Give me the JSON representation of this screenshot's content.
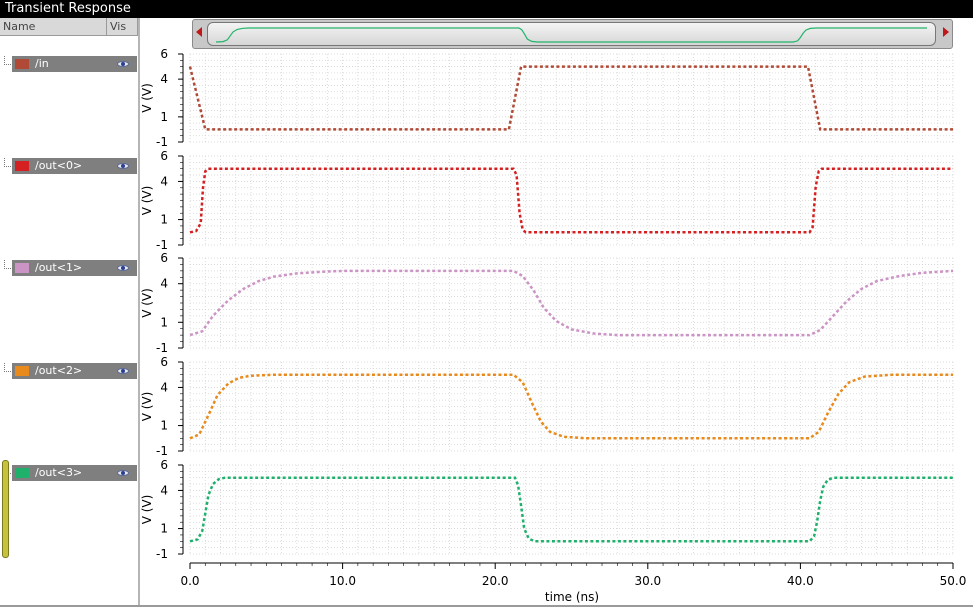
{
  "window": {
    "title": "Transient Response"
  },
  "legend_panel": {
    "col_name": "Name",
    "col_vis": "Vis",
    "signals": [
      {
        "label": "/in",
        "color": "#b04a36"
      },
      {
        "label": "/out<0>",
        "color": "#d42020"
      },
      {
        "label": "/out<1>",
        "color": "#cc94c4"
      },
      {
        "label": "/out<2>",
        "color": "#e88a1c"
      },
      {
        "label": "/out<3>",
        "color": "#1fb06c"
      }
    ]
  },
  "chart_data": {
    "type": "line",
    "xlabel": "time (ns)",
    "xlim": [
      0,
      50
    ],
    "xticks": [
      "0.0",
      "10.0",
      "20.0",
      "30.0",
      "40.0",
      "50.0"
    ],
    "ylabel": "V (V)",
    "ylim": [
      -1,
      6
    ],
    "yticks": [
      "6",
      "4",
      "1",
      "-1"
    ],
    "grid": true,
    "series": [
      {
        "name": "/in",
        "color": "#b04a36",
        "x": [
          0,
          1.0,
          20.9,
          21.7,
          40.5,
          41.3,
          50
        ],
        "y": [
          5,
          0,
          0,
          5,
          5,
          0,
          0
        ]
      },
      {
        "name": "/out<0>",
        "color": "#d42020",
        "x": [
          0,
          0.4,
          0.7,
          0.85,
          1.0,
          1.2,
          21.2,
          21.4,
          21.6,
          21.8,
          22.0,
          40.6,
          40.8,
          41.0,
          41.2,
          41.4,
          50
        ],
        "y": [
          0,
          0.1,
          0.7,
          3.5,
          4.8,
          5,
          5,
          4.5,
          1.5,
          0.2,
          0,
          0,
          0.4,
          3.6,
          4.8,
          5,
          5
        ]
      },
      {
        "name": "/out<1>",
        "color": "#cc94c4",
        "x": [
          0,
          0.8,
          1.5,
          2.5,
          3.5,
          4.5,
          5.5,
          7,
          8.5,
          10,
          21.2,
          21.8,
          22.5,
          23.2,
          24,
          25,
          26.5,
          28,
          40.6,
          41.3,
          42,
          43,
          44,
          45,
          46.5,
          48,
          50
        ],
        "y": [
          0,
          0.3,
          1.5,
          2.7,
          3.6,
          4.2,
          4.55,
          4.8,
          4.92,
          5,
          5,
          4.6,
          3.5,
          2.1,
          1.1,
          0.45,
          0.12,
          0,
          0,
          0.4,
          1.3,
          2.6,
          3.6,
          4.2,
          4.6,
          4.85,
          5
        ]
      },
      {
        "name": "/out<2>",
        "color": "#e88a1c",
        "x": [
          0,
          0.6,
          1.2,
          1.8,
          2.5,
          3.2,
          4,
          5.5,
          21.2,
          21.8,
          22.4,
          23.0,
          23.6,
          24.5,
          26,
          40.6,
          41.2,
          41.8,
          42.5,
          43.2,
          44.2,
          46,
          50
        ],
        "y": [
          0,
          0.3,
          1.8,
          3.4,
          4.3,
          4.75,
          4.92,
          5,
          5,
          4.4,
          2.8,
          1.3,
          0.5,
          0.12,
          0,
          0,
          0.5,
          2.0,
          3.5,
          4.4,
          4.85,
          5,
          5
        ]
      },
      {
        "name": "/out<3>",
        "color": "#1fb06c",
        "x": [
          0,
          0.5,
          0.8,
          1.0,
          1.2,
          1.5,
          1.9,
          2.3,
          21.3,
          21.5,
          21.7,
          21.9,
          22.2,
          22.6,
          40.6,
          40.9,
          41.1,
          41.3,
          41.5,
          41.8,
          42.2,
          50
        ],
        "y": [
          0,
          0.15,
          0.8,
          2.2,
          3.6,
          4.5,
          4.9,
          5,
          5,
          4.4,
          2.8,
          1.0,
          0.2,
          0,
          0,
          0.4,
          1.6,
          3.2,
          4.3,
          4.85,
          5,
          5
        ]
      }
    ]
  }
}
